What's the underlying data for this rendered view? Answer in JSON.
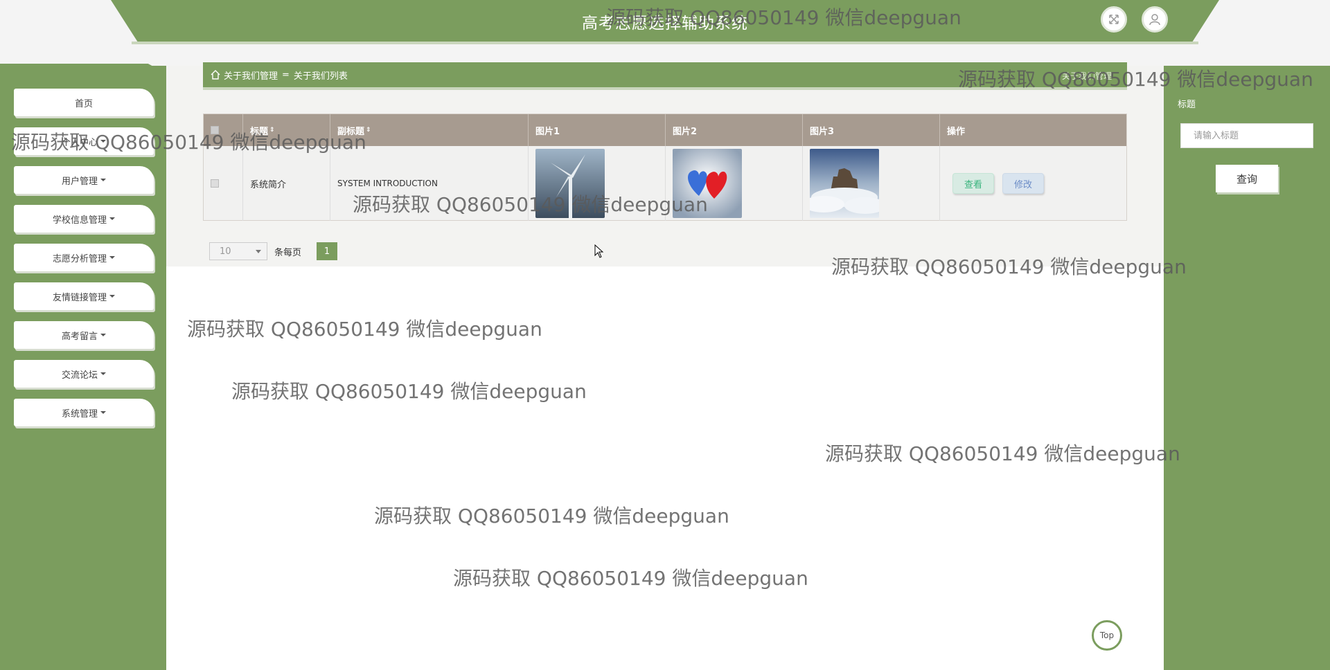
{
  "header": {
    "title": "高考志愿选择辅助系统"
  },
  "sidebar": {
    "items": [
      {
        "label": "首页",
        "has_caret": false
      },
      {
        "label": "个人中心",
        "has_caret": true
      },
      {
        "label": "用户管理",
        "has_caret": true
      },
      {
        "label": "学校信息管理",
        "has_caret": true
      },
      {
        "label": "志愿分析管理",
        "has_caret": true
      },
      {
        "label": "友情链接管理",
        "has_caret": true
      },
      {
        "label": "高考留言",
        "has_caret": true
      },
      {
        "label": "交流论坛",
        "has_caret": true
      },
      {
        "label": "系统管理",
        "has_caret": true
      }
    ]
  },
  "breadcrumb": {
    "parent": "关于我们管理",
    "separator": "=",
    "current": "关于我们列表",
    "right_label": "关于我们管理"
  },
  "table": {
    "columns": [
      "标题",
      "副标题",
      "图片1",
      "图片2",
      "图片3",
      "操作"
    ],
    "rows": [
      {
        "title": "系统简介",
        "subtitle": "SYSTEM INTRODUCTION",
        "view_label": "查看",
        "edit_label": "修改"
      }
    ]
  },
  "pager": {
    "page_size": "10",
    "per_page_label": "条每页",
    "current_page": "1"
  },
  "search": {
    "label": "标题",
    "placeholder": "请输入标题",
    "button_label": "查询"
  },
  "top_button": {
    "label": "Top"
  },
  "watermark": {
    "text": "源码获取 QQ86050149 微信deepguan"
  },
  "colors": {
    "accent": "#7b9d5e",
    "table_header": "#a79b90",
    "view_btn": "#37b37c",
    "edit_btn": "#6b8cc7"
  }
}
